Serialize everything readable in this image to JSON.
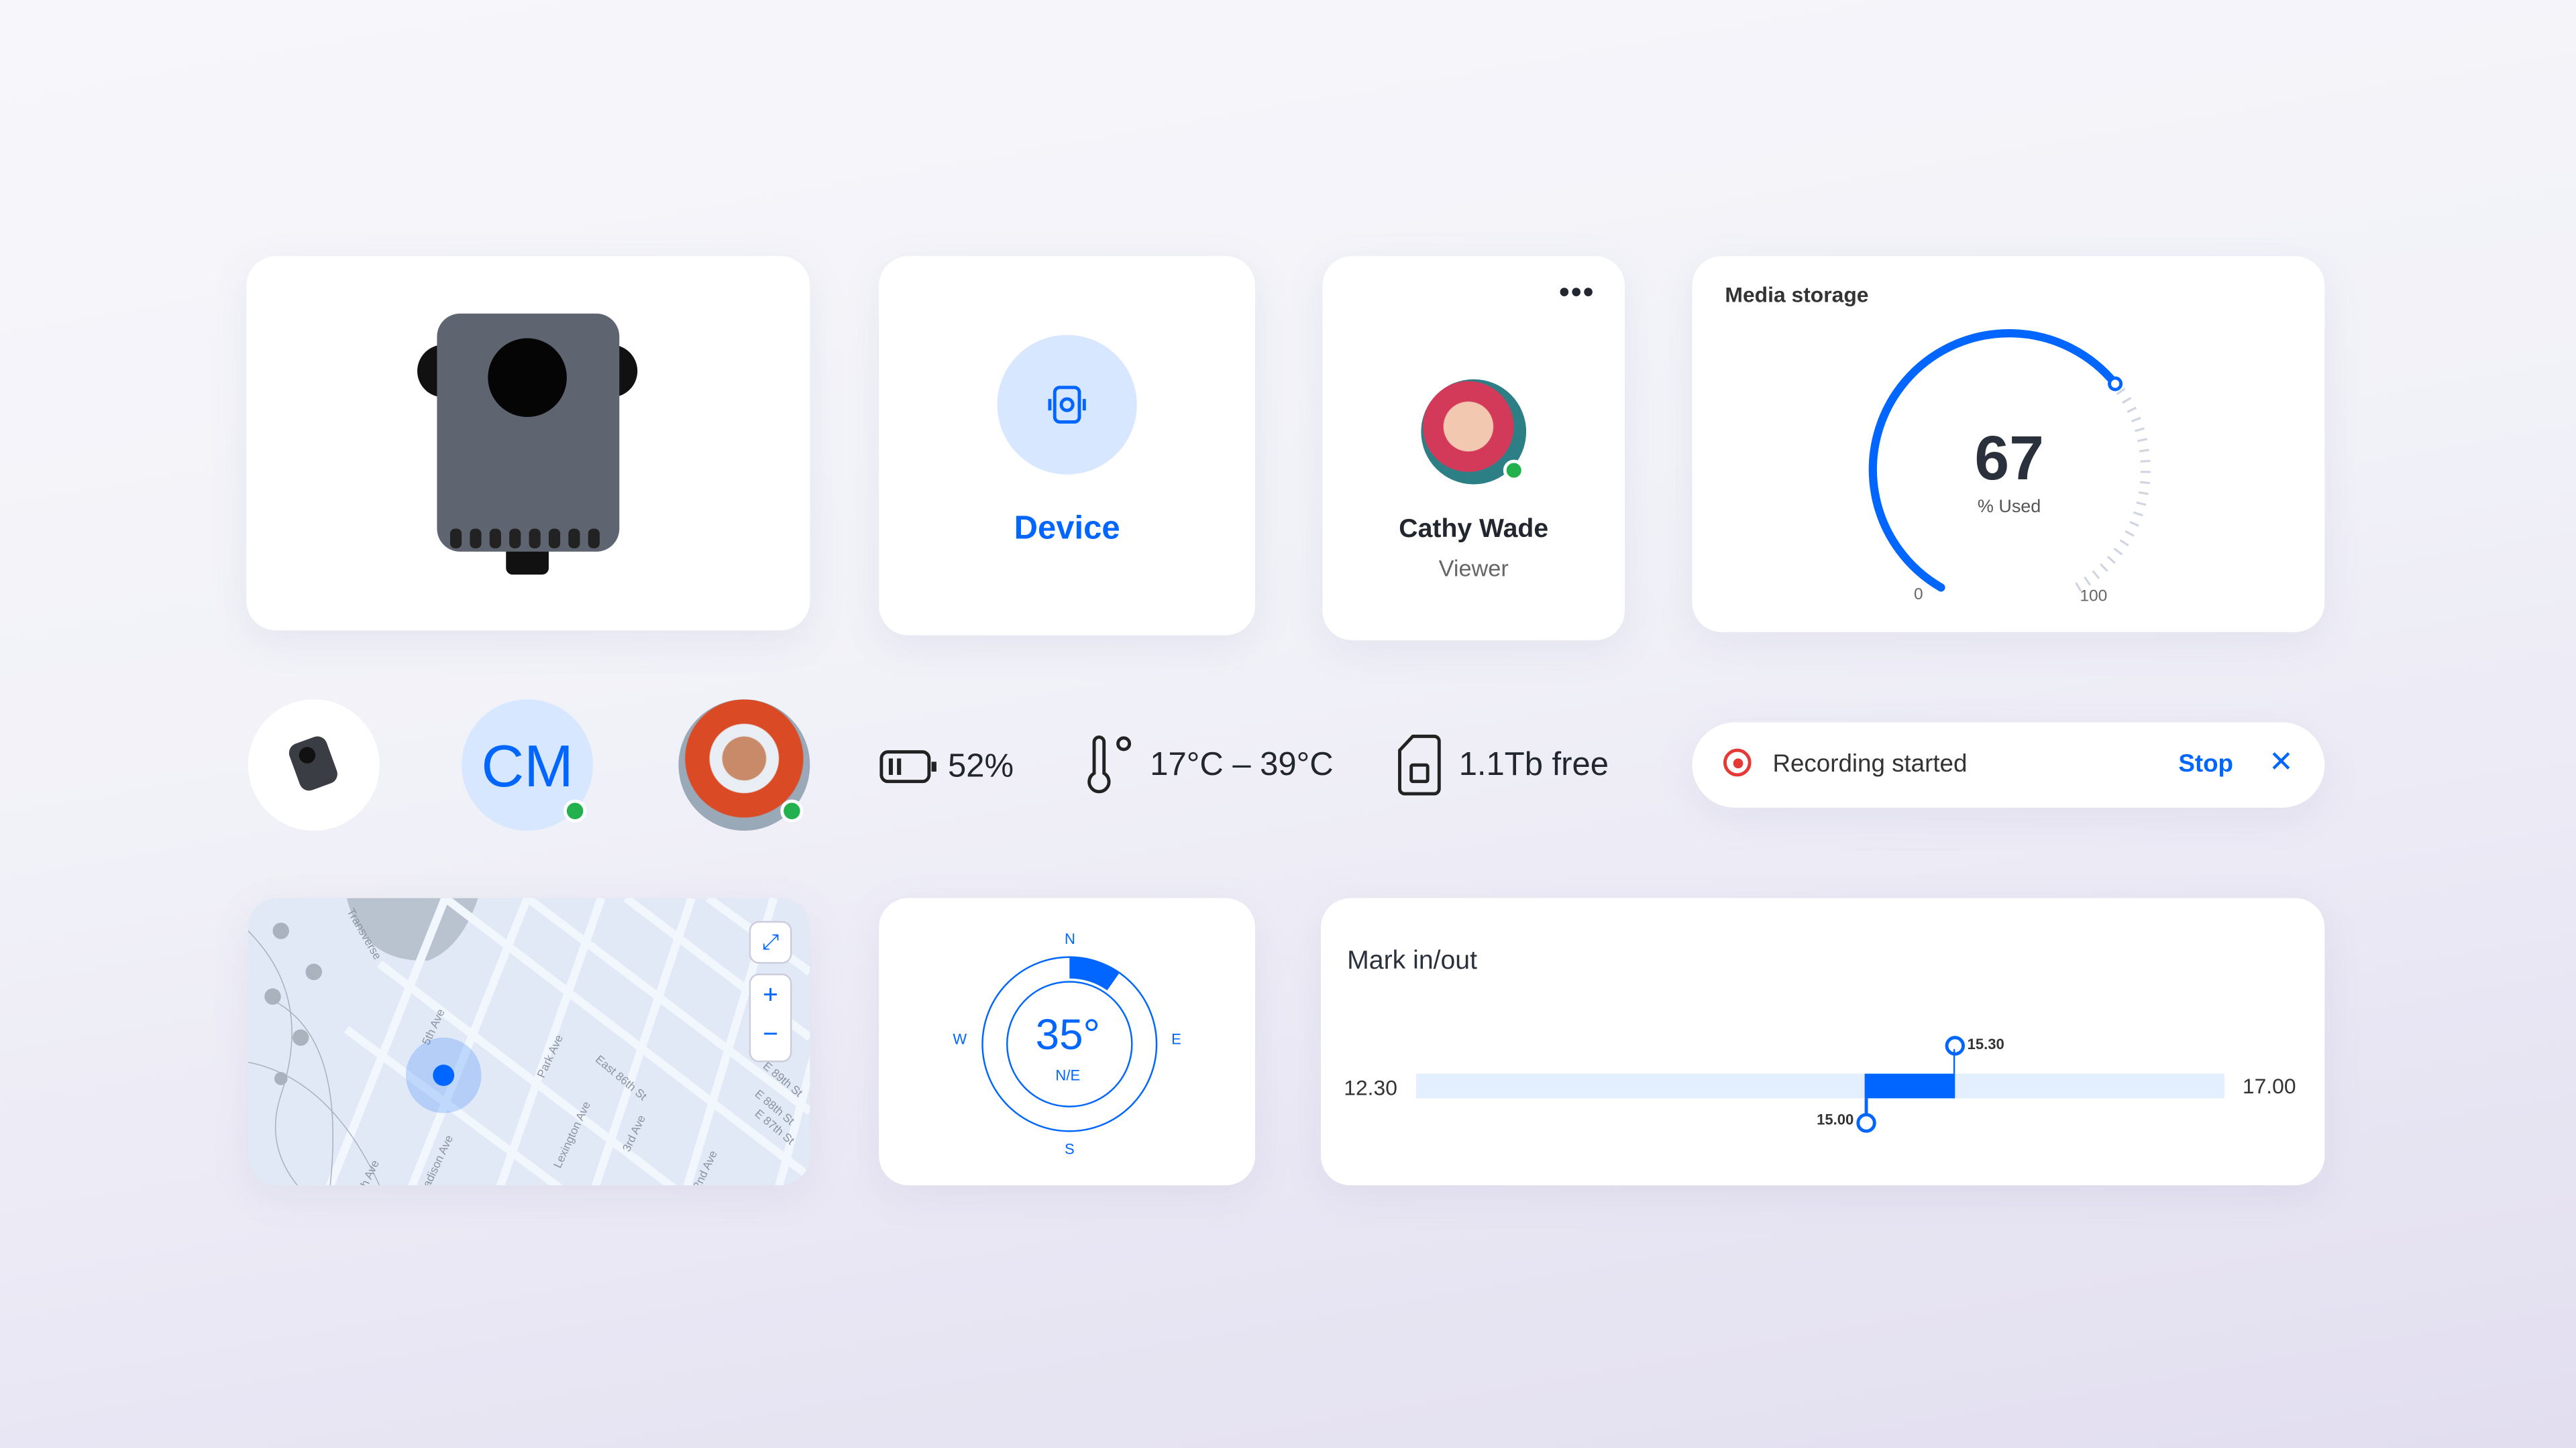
{
  "device_card": {
    "label": "Device",
    "icon": "device-icon"
  },
  "profile_card": {
    "name": "Cathy Wade",
    "role": "Viewer",
    "status": "online",
    "menu_icon": "more-horizontal-icon"
  },
  "media_storage": {
    "title": "Media storage",
    "value": "67",
    "unit_label": "% Used",
    "min_label": "0",
    "max_label": "100",
    "percent_used": 67
  },
  "avatars": {
    "initials": "CM"
  },
  "stats": {
    "battery": "52%",
    "temperature": "17°C – 39°C",
    "storage": "1.1Tb free"
  },
  "recording": {
    "text": "Recording started",
    "stop_label": "Stop"
  },
  "map": {
    "streets": [
      "Transverse",
      "5th Ave",
      "Park Ave",
      "East 86th St",
      "Lexington Ave",
      "3rd Ave",
      "E 89th St",
      "E 88th St",
      "E 87th St",
      "2nd Ave",
      "Madison Ave",
      "5th Ave"
    ]
  },
  "compass": {
    "heading": "35°",
    "direction": "N/E",
    "n": "N",
    "e": "E",
    "s": "S",
    "w": "W",
    "heading_deg": 35
  },
  "mark_in_out": {
    "title": "Mark in/out",
    "start": "12.30",
    "end": "17.00",
    "mark_in": "15.00",
    "mark_out": "15.30"
  },
  "colors": {
    "accent": "#0066ff",
    "accent_light": "#d6e7ff",
    "online": "#22b14c",
    "record": "#e53935"
  }
}
